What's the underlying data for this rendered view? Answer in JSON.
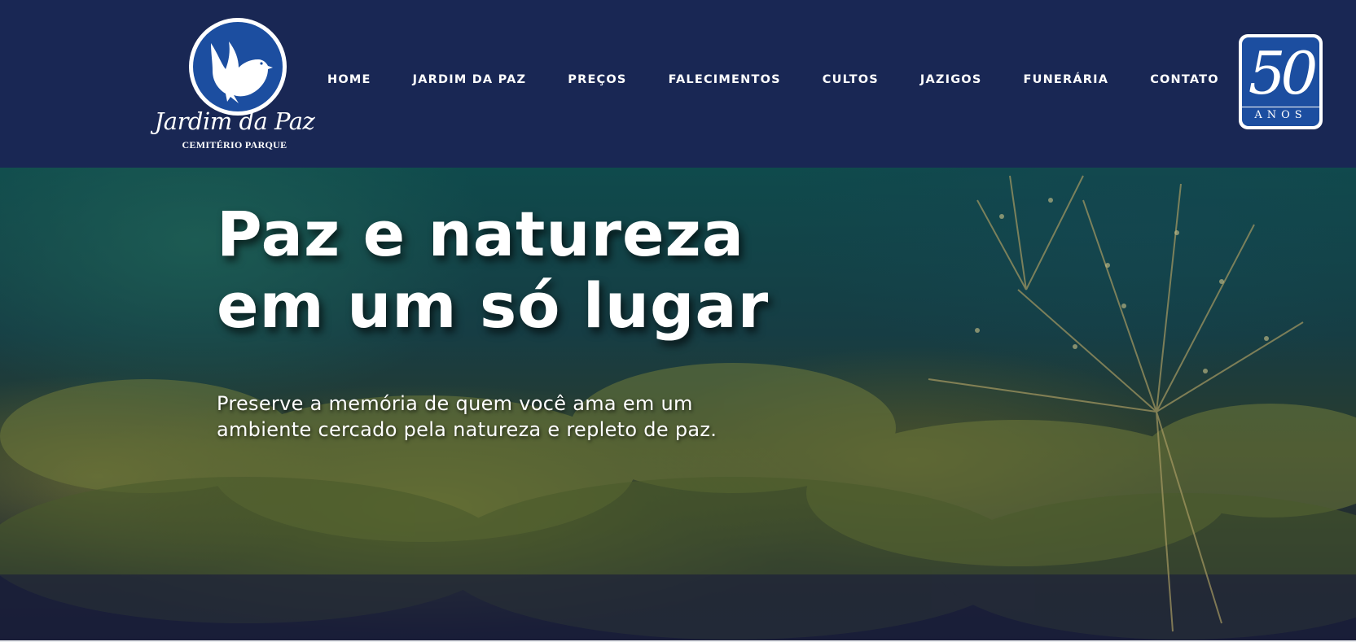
{
  "logo": {
    "script_text": "Jardim da Paz",
    "subtitle": "CEMITÉRIO PARQUE",
    "icon": "dove-icon"
  },
  "nav": {
    "items": [
      {
        "label": "HOME"
      },
      {
        "label": "JARDIM DA PAZ"
      },
      {
        "label": "PREÇOS"
      },
      {
        "label": "FALECIMENTOS"
      },
      {
        "label": "CULTOS"
      },
      {
        "label": "JAZIGOS"
      },
      {
        "label": "FUNERÁRIA"
      },
      {
        "label": "CONTATO"
      }
    ]
  },
  "badge": {
    "number": "50",
    "label": "ANOS"
  },
  "hero": {
    "title_line1": "Paz e natureza",
    "title_line2": "em um só lugar",
    "text_line1": "Preserve a memória de quem você ama em um",
    "text_line2": "ambiente cercado pela natureza e repleto de paz."
  },
  "colors": {
    "header_bg": "#192754",
    "logo_blue": "#1c4ea0",
    "text": "#ffffff"
  }
}
